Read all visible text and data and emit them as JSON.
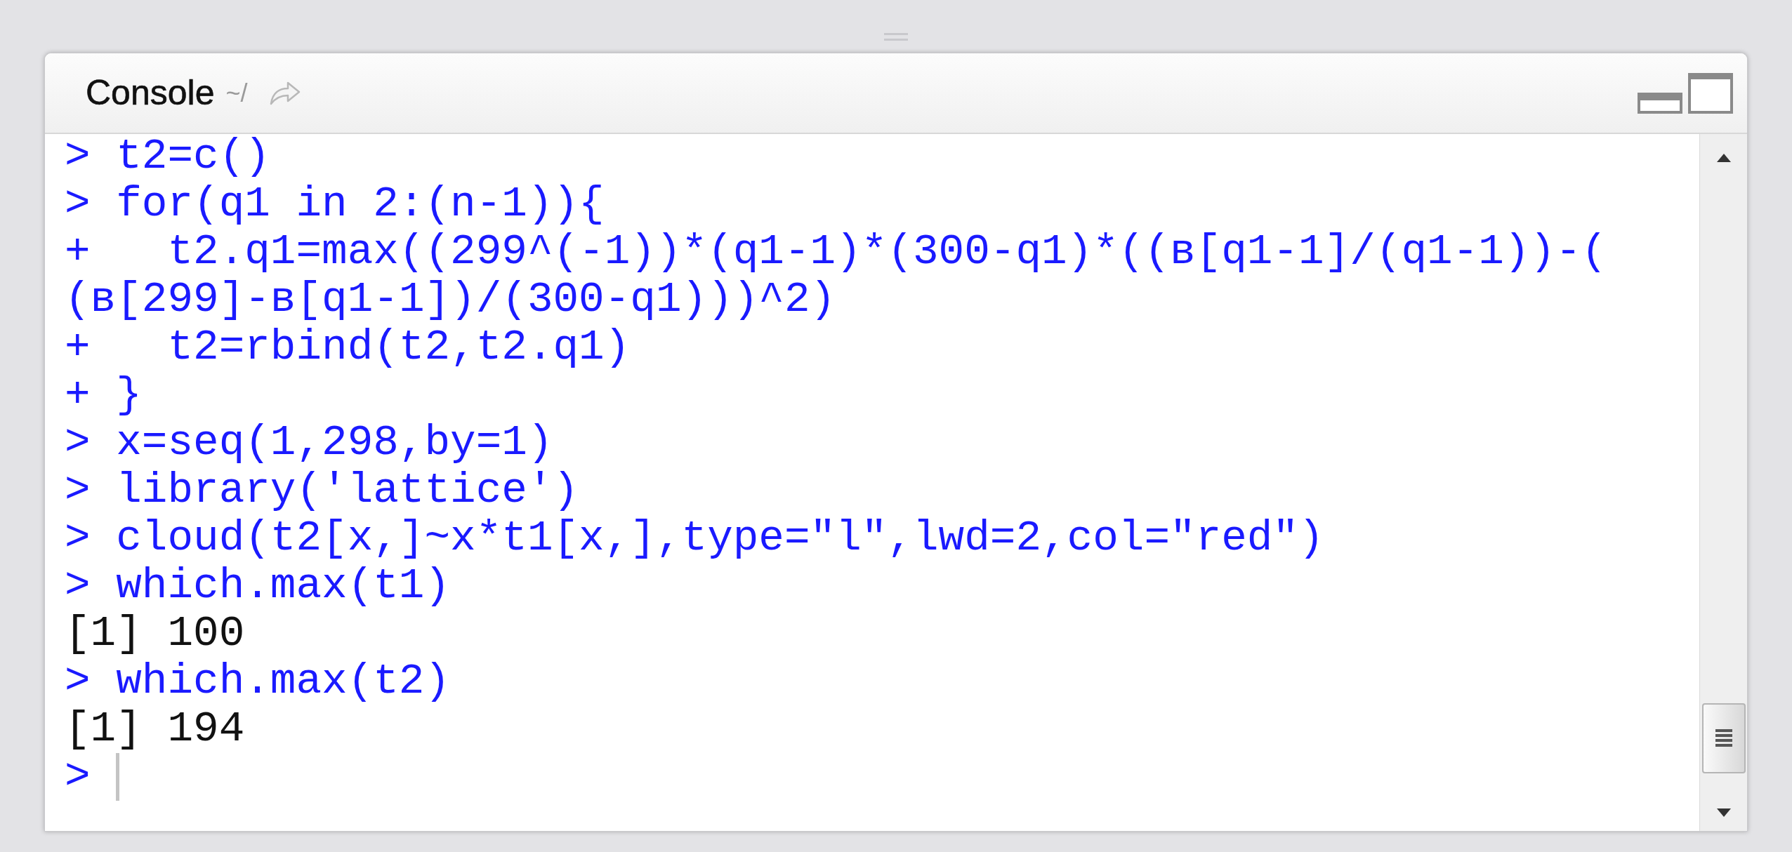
{
  "panel": {
    "title": "Console",
    "path": "~/"
  },
  "console_lines": [
    {
      "kind": "input",
      "prompt": ">",
      "text": "t2=c()"
    },
    {
      "kind": "input",
      "prompt": ">",
      "text": "for(q1 in 2:(n-1)){"
    },
    {
      "kind": "input",
      "prompt": "+",
      "text": "  t2.q1=max((299^(-1))*(q1-1)*(300-q1)*((в[q1-1]/(q1-1))-("
    },
    {
      "kind": "continuation",
      "text": "(в[299]-в[q1-1])/(300-q1)))^2)"
    },
    {
      "kind": "input",
      "prompt": "+",
      "text": "  t2=rbind(t2,t2.q1)"
    },
    {
      "kind": "input",
      "prompt": "+",
      "text": "}"
    },
    {
      "kind": "input",
      "prompt": ">",
      "text": "x=seq(1,298,by=1)"
    },
    {
      "kind": "input",
      "prompt": ">",
      "text": "library('lattice')"
    },
    {
      "kind": "input",
      "prompt": ">",
      "text": "cloud(t2[x,]~x*t1[x,],type=\"l\",lwd=2,col=\"red\")"
    },
    {
      "kind": "input",
      "prompt": ">",
      "text": "which.max(t1)"
    },
    {
      "kind": "output",
      "text": "[1] 100"
    },
    {
      "kind": "input",
      "prompt": ">",
      "text": "which.max(t2)"
    },
    {
      "kind": "output",
      "text": "[1] 194"
    }
  ],
  "current_prompt": ">"
}
